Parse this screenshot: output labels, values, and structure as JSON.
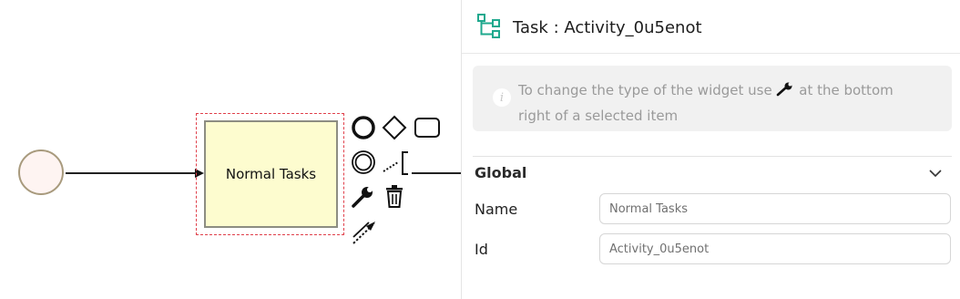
{
  "canvas": {
    "task": {
      "label": "Normal Tasks"
    }
  },
  "context_pad": {
    "icons": [
      "end-event-icon",
      "gateway-icon",
      "task-icon",
      "intermediate-event-icon",
      "text-annotation-icon",
      "change-type-icon",
      "delete-icon",
      "connect-icon"
    ]
  },
  "panel": {
    "header_icon": "task-tree-icon",
    "title": "Task : Activity_0u5enot",
    "info": {
      "text_before": "To change the type of the widget use ",
      "icon": "wrench-icon",
      "text_after": " at the bottom right of a selected item"
    },
    "group": {
      "title": "Global",
      "expanded": true,
      "fields": [
        {
          "label": "Name",
          "value": "Normal Tasks"
        },
        {
          "label": "Id",
          "value": "Activity_0u5enot"
        }
      ]
    }
  },
  "colors": {
    "header_icon": "#1fa98e",
    "selection": "#e0404b",
    "task_fill": "#fdfccf",
    "start_event_fill": "#fef4f2"
  }
}
